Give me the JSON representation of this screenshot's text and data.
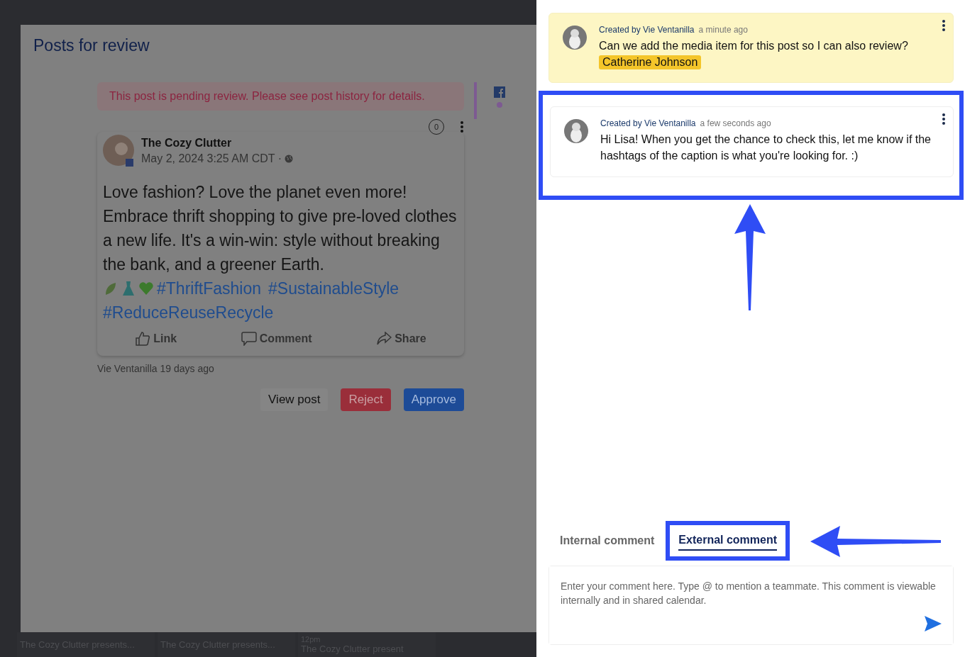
{
  "modal": {
    "title": "Posts for review"
  },
  "alert": {
    "text": "This post is pending review. Please see post history for details."
  },
  "post": {
    "comment_count": "0",
    "page_name": "The Cozy Clutter",
    "timestamp": "May 2, 2024 3:25 AM CDT ·",
    "text": "Love fashion? Love the planet even more! Embrace thrift shopping to give pre-loved clothes a new life. It's a win-win: style without breaking the bank, and a greener Earth.",
    "hashtags": [
      "#ThriftFashion",
      "#SustainableStyle",
      "#ReduceReuseRecycle"
    ],
    "actions": [
      {
        "label": "Link",
        "kind": "like"
      },
      {
        "label": "Comment",
        "kind": "comment"
      },
      {
        "label": "Share",
        "kind": "share"
      }
    ]
  },
  "history": "Vie Ventanilla 19 days ago",
  "buttons": [
    {
      "label": "View post",
      "kind": "plain"
    },
    {
      "label": "Reject",
      "kind": "danger"
    },
    {
      "label": "Approve",
      "kind": "primary"
    }
  ],
  "calendar_events": [
    {
      "title": "The Cozy Clutter presents..."
    },
    {
      "title": "The Cozy Clutter presents..."
    },
    {
      "time": "12pm",
      "title": "The Cozy Clutter present"
    }
  ],
  "comments": [
    {
      "author": "Created by Vie Ventanilla",
      "time": "a minute ago",
      "text": "Can we add the media item for this post so I can also review?",
      "mention": "Catherine Johnson",
      "highlighted": true
    },
    {
      "author": "Created by Vie Ventanilla",
      "time": "a few seconds ago",
      "text": "Hi Lisa! When you get the chance to check this, let me know if the hashtags of the caption is what you're looking for. :)",
      "highlighted": false
    }
  ],
  "comment_tabs": [
    {
      "label": "Internal comment",
      "selected": false
    },
    {
      "label": "External comment",
      "selected": true
    }
  ],
  "comment_input": {
    "placeholder": "Enter your comment here. Type @ to mention a teammate. This comment is viewable internally and in shared calendar."
  }
}
